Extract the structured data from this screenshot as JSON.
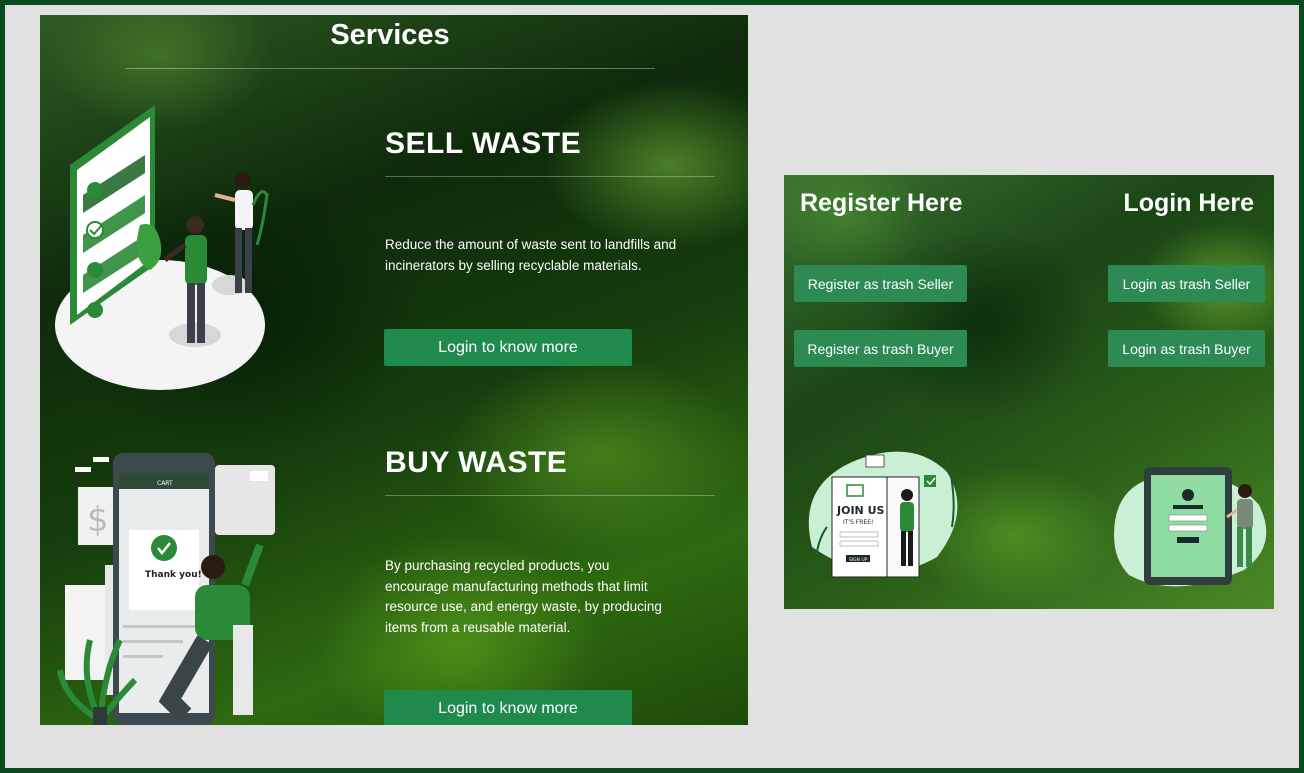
{
  "services": {
    "title": "Services",
    "sell": {
      "heading": "SELL WASTE",
      "text": "Reduce the amount of waste sent to landfills and incinerators by selling recyclable materials.",
      "button": "Login to know more"
    },
    "buy": {
      "heading": "BUY WASTE",
      "text": "By purchasing recycled products, you encourage manufacturing methods that limit resource use, and energy waste, by producing items from a reusable material.",
      "button": "Login to know more",
      "phone_thankyou": "Thank you!",
      "phone_cart": "CART"
    }
  },
  "auth": {
    "register_heading": "Register Here",
    "login_heading": "Login Here",
    "register_seller": "Register as trash Seller",
    "register_buyer": "Register as trash Buyer",
    "login_seller": "Login as trash Seller",
    "login_buyer": "Login as trash Buyer",
    "join_us": "JOIN US",
    "join_free": "IT'S FREE!",
    "sign_up": "SIGN UP"
  },
  "colors": {
    "frame": "#0b4a1f",
    "background": "#e1e1e1",
    "button": "#1f8a4c",
    "accent": "#2c8a52"
  },
  "icons": [
    "checklist-illustration",
    "shopping-phone-illustration",
    "join-us-illustration",
    "login-illustration",
    "dollar-icon",
    "check-icon"
  ]
}
